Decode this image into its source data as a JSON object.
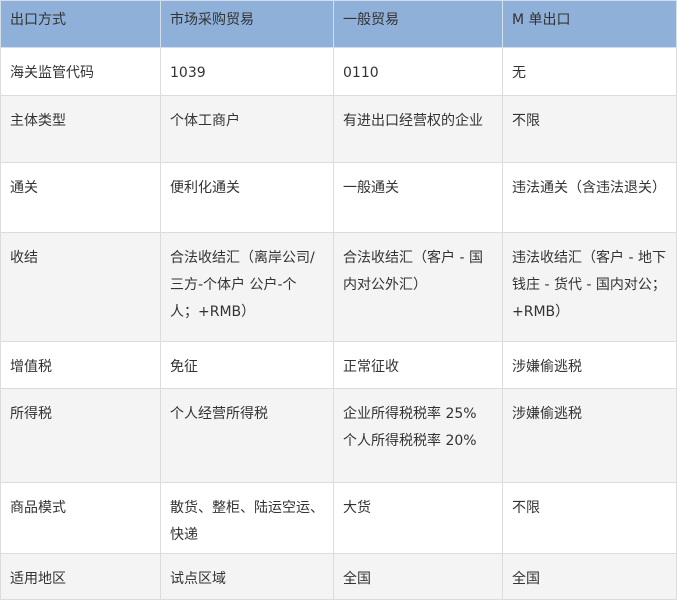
{
  "headers": [
    "出口方式",
    "市场采购贸易",
    "一般贸易",
    "M 单出口"
  ],
  "rows": [
    [
      "海关监管代码",
      "1039",
      "0110",
      "无"
    ],
    [
      "主体类型",
      "个体工商户",
      "有进出口经营权的企业",
      "不限"
    ],
    [
      "通关",
      "便利化通关",
      "一般通关",
      "违法通关（含违法退关）"
    ],
    [
      "收结",
      "合法收结汇（离岸公司/三方-个体户 公户-个人；+RMB）",
      "合法收结汇（客户 - 国内对公外汇）",
      "违法收结汇（客户 - 地下钱庄 - 货代 - 国内对公；+RMB）"
    ],
    [
      "增值税",
      "免征",
      "正常征收",
      "涉嫌偷逃税"
    ],
    [
      "所得税",
      "个人经营所得税",
      "企业所得税税率 25%\n个人所得税税率 20%",
      "涉嫌偷逃税"
    ],
    [
      "商品模式",
      "散货、整柜、陆运空运、快递",
      "大货",
      "不限"
    ],
    [
      "适用地区",
      "试点区域",
      "全国",
      "全国"
    ]
  ],
  "colors": {
    "header_bg": "#8fb0d8",
    "stripe_bg": "#f4f4f4",
    "border": "#dcdcdc",
    "text": "#333333"
  }
}
